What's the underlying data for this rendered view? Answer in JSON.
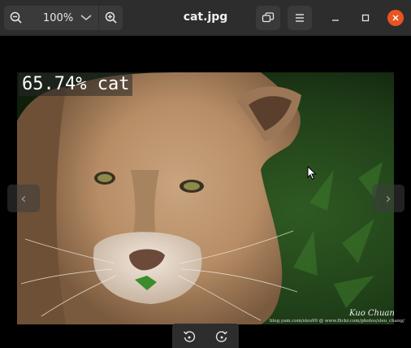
{
  "window": {
    "title": "cat.jpg"
  },
  "toolbar": {
    "zoom_level": "100%",
    "zoom_out_icon": "zoom-out-icon",
    "zoom_in_icon": "zoom-in-icon"
  },
  "image": {
    "classification_label": "65.74% cat",
    "credit_text": "blog.yam.com/sleu99 @ www.flickr.com/photos/sleu_chang/",
    "signature": "Kuo Chuan"
  },
  "colors": {
    "titlebar": "#2d2d2d",
    "button": "#3a3a3a",
    "close": "#e95420",
    "canvas": "#000000"
  }
}
